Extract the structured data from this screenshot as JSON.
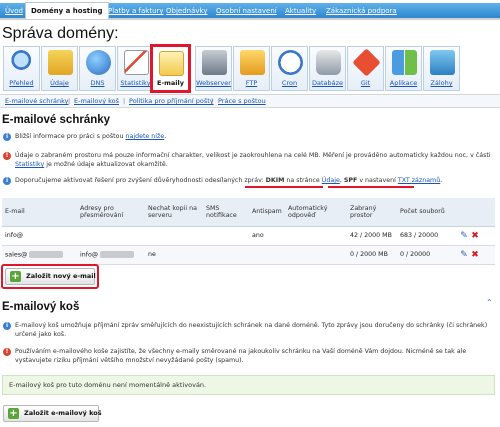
{
  "topnav": {
    "tabs": [
      {
        "label": "Úvod",
        "active": false
      },
      {
        "label": "Domény a hosting",
        "active": true
      },
      {
        "label": "Platby a faktury",
        "active": false
      },
      {
        "label": "Objednávky",
        "active": false
      },
      {
        "label": "Osobní nastavení",
        "active": false
      },
      {
        "label": "Aktuality",
        "active": false
      },
      {
        "label": "Zákaznická podpora",
        "active": false
      }
    ]
  },
  "page_title": "Správa domény:",
  "toolbar": {
    "items": [
      {
        "label": "Přehled",
        "icon": "magnifier-icon"
      },
      {
        "label": "Údaje",
        "icon": "upload-icon"
      },
      {
        "label": "DNS",
        "icon": "globe-icon"
      },
      {
        "label": "Statistiky",
        "icon": "chart-icon"
      },
      {
        "label": "E-maily",
        "icon": "envelope-icon",
        "selected": true
      },
      {
        "label": "Webserver",
        "icon": "server-icon"
      },
      {
        "label": "FTP",
        "icon": "folder-icon"
      },
      {
        "label": "Cron",
        "icon": "clock-icon"
      },
      {
        "label": "Databáze",
        "icon": "database-icon"
      },
      {
        "label": "Git",
        "icon": "git-icon"
      },
      {
        "label": "Aplikace",
        "icon": "apps-icon"
      },
      {
        "label": "Zálohy",
        "icon": "backup-icon"
      }
    ]
  },
  "subnav": {
    "links": [
      "E-mailové schránky",
      "E-mailový koš",
      "Politika pro příjmání pošty",
      "Práce s poštou"
    ]
  },
  "mailboxes": {
    "title": "E-mailové schránky",
    "info1_before": "Bližší informace pro práci s poštou ",
    "info1_link": "najdete níže",
    "info1_after": ".",
    "info2_before": "Údaje o zabraném prostoru má pouze informační charakter, velikost je zaokrouhlena na celé MB. Měření je prováděno automaticky každou noc, v části ",
    "info2_link": "Statistiky",
    "info2_after": " je možné údaje aktualizovat okamžitě.",
    "info3_before": "Doporučujeme aktivovat řešení pro zvýšení důvěryhodnosti odesílaných zpráv: ",
    "info3_dkim": "DKIM",
    "info3_mid": " na stránce ",
    "info3_link1": "Údaje",
    "info3_comma": ", ",
    "info3_spf": "SPF",
    "info3_mid2": " v nastavení ",
    "info3_link2": "TXT záznamů",
    "info3_end": ".",
    "columns": [
      "E-mail",
      "Adresy pro přesměrování",
      "Nechat kopii na serveru",
      "SMS notifikace",
      "Antispam",
      "Automatický odpověď",
      "Zabraný prostor",
      "Počet souborů"
    ],
    "rows": [
      {
        "email": "info@",
        "forward": "",
        "copy": "",
        "sms": "",
        "antispam": "ano",
        "autoreply": "",
        "space": "42 / 2000 MB",
        "files": "683 / 20000"
      },
      {
        "email": "sales@",
        "forward": "info@",
        "copy": "ne",
        "sms": "",
        "antispam": "",
        "autoreply": "",
        "space": "0 / 2000 MB",
        "files": "0 / 20000"
      }
    ],
    "add_button": "Založit nový e-mail"
  },
  "trash": {
    "title": "E-mailový koš",
    "info1": "E-mailový koš umožňuje příjmání zpráv směřujících do neexistujících schránek na dané doméně. Tyto zprávy jsou doručeny do schránky (či schránek) určené jako koš.",
    "info2": "Používáním e-mailového koše zajistíte, že všechny e-maily směrované na jakoukoliv schránku na Vaší doméně Vám dojdou. Nicméně se tak ale vystavujete riziku příjmání většího množství nevyžádané pošty (spamu).",
    "notice": "E-mailový koš pro tuto doménu není momentálně aktivován.",
    "add_button": "Založit e-mailový koš"
  }
}
